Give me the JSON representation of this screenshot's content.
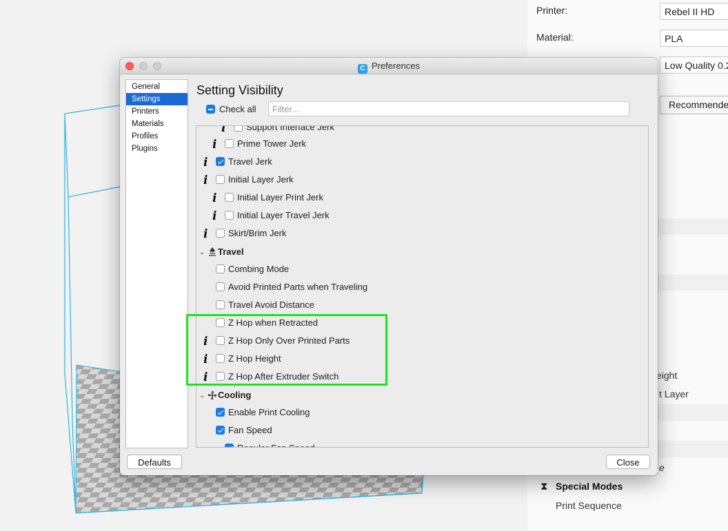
{
  "side_panel": {
    "printer_label": "Printer:",
    "printer_value": "Rebel II HD",
    "material_label": "Material:",
    "material_value": "PLA",
    "profile_value": "Low Quality 0.2",
    "mode_button": "Recommended",
    "partial_text_1": "eight",
    "partial_text_2": "t Layer",
    "partial_text_3": "e",
    "special_modes": "Special Modes",
    "print_sequence": "Print Sequence"
  },
  "dialog": {
    "title": "Preferences",
    "app_icon_letter": "C",
    "nav": [
      "General",
      "Settings",
      "Printers",
      "Materials",
      "Profiles",
      "Plugins"
    ],
    "selected_nav": "Settings",
    "heading": "Setting Visibility",
    "check_all_label": "Check all",
    "filter_placeholder": "Filter...",
    "rows": [
      {
        "label": "Support Interface Jerk",
        "checked": false,
        "info": true
      },
      {
        "label": "Prime Tower Jerk",
        "checked": false,
        "info": true
      },
      {
        "label": "Travel Jerk",
        "checked": true,
        "info": true
      },
      {
        "label": "Initial Layer Jerk",
        "checked": false,
        "info": true
      },
      {
        "label": "Initial Layer Print Jerk",
        "checked": false,
        "info": true
      },
      {
        "label": "Initial Layer Travel Jerk",
        "checked": false,
        "info": true
      },
      {
        "label": "Skirt/Brim Jerk",
        "checked": false,
        "info": true
      },
      {
        "label": "Travel",
        "category": true
      },
      {
        "label": "Combing Mode",
        "checked": false,
        "info": false
      },
      {
        "label": "Avoid Printed Parts when Traveling",
        "checked": false,
        "info": false
      },
      {
        "label": "Travel Avoid Distance",
        "checked": false,
        "info": false
      },
      {
        "label": "Z Hop when Retracted",
        "checked": false,
        "info": false
      },
      {
        "label": "Z Hop Only Over Printed Parts",
        "checked": false,
        "info": true
      },
      {
        "label": "Z Hop Height",
        "checked": false,
        "info": true
      },
      {
        "label": "Z Hop After Extruder Switch",
        "checked": false,
        "info": true
      },
      {
        "label": "Cooling",
        "category": true
      },
      {
        "label": "Enable Print Cooling",
        "checked": true,
        "info": false
      },
      {
        "label": "Fan Speed",
        "checked": true,
        "info": false
      },
      {
        "label": "Regular Fan Speed",
        "checked": true,
        "info": false
      }
    ],
    "info_glyph": "i",
    "chevron_glyph": "⌄",
    "defaults_button": "Defaults",
    "close_button": "Close"
  },
  "colors": {
    "accent": "#1a78e8",
    "highlight": "#19e619",
    "viewport_line": "#2bb4e0"
  }
}
